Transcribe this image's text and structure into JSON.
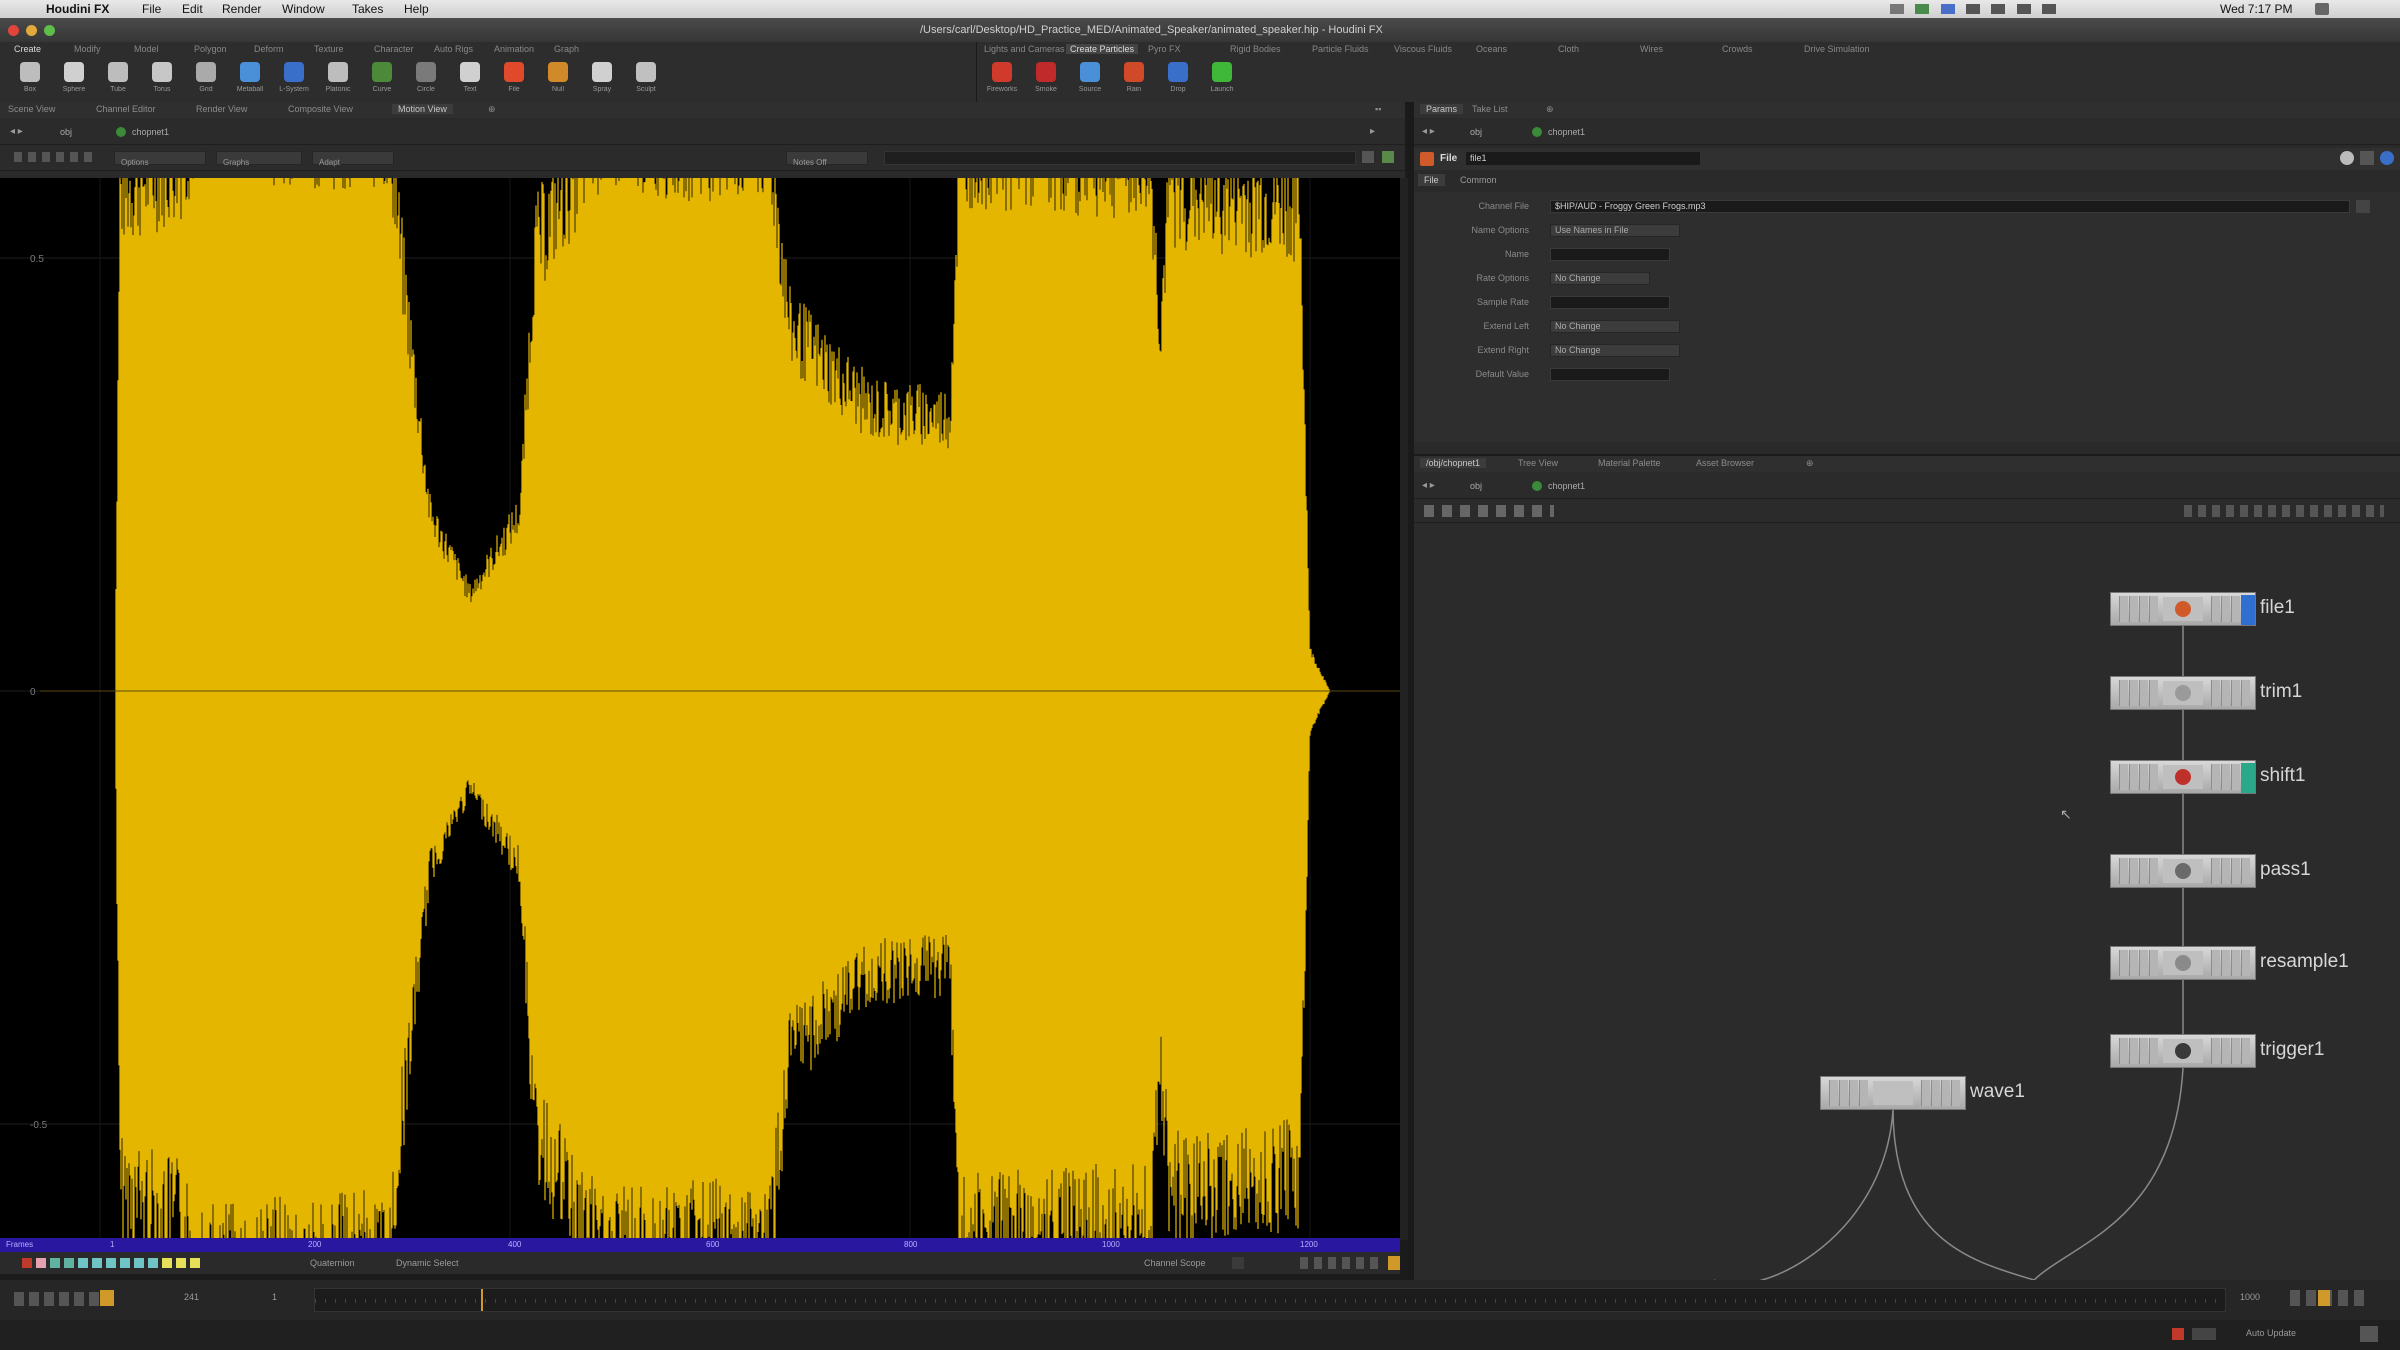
{
  "menubar": {
    "app": "Houdini FX",
    "items": [
      "File",
      "Edit",
      "Render",
      "Window",
      "Takes",
      "Help"
    ],
    "clock": "Wed 7:17 PM"
  },
  "titlebar": {
    "title": "/Users/carl/Desktop/HD_Practice_MED/Animated_Speaker/animated_speaker.hip - Houdini FX"
  },
  "shelf": {
    "left_tabs": [
      "Create",
      "Modify",
      "Model",
      "Polygon",
      "Deform",
      "Texture",
      "Character",
      "Auto Rigs",
      "Animation",
      "Graph"
    ],
    "right_tabs": [
      "Lights and Cameras",
      "Create Particles",
      "Pyro FX",
      "Rigid Bodies",
      "Particle Fluids",
      "Viscous Fluids",
      "Oceans",
      "Cloth",
      "Wires",
      "Crowds",
      "Drive Simulation"
    ],
    "left_tools": [
      {
        "label": "Box",
        "color": "#bdbdbd"
      },
      {
        "label": "Sphere",
        "color": "#d0d0d0"
      },
      {
        "label": "Tube",
        "color": "#bdbdbd"
      },
      {
        "label": "Torus",
        "color": "#c7c7c7"
      },
      {
        "label": "Grid",
        "color": "#aaaaaa"
      },
      {
        "label": "Metaball",
        "color": "#4a90d9"
      },
      {
        "label": "L-System",
        "color": "#3a6fc9"
      },
      {
        "label": "Platonic",
        "color": "#bdbdbd"
      },
      {
        "label": "Curve",
        "color": "#4c8a3a"
      },
      {
        "label": "Circle",
        "color": "#7a7a7a"
      },
      {
        "label": "Text",
        "color": "#d0d0d0"
      },
      {
        "label": "File",
        "color": "#e0492a"
      },
      {
        "label": "Null",
        "color": "#d08a2a"
      },
      {
        "label": "Spray",
        "color": "#d0d0d0"
      },
      {
        "label": "Sculpt",
        "color": "#c0c0c0"
      }
    ],
    "right_tools": [
      {
        "label": "Fireworks",
        "color": "#d03a2a"
      },
      {
        "label": "Smoke",
        "color": "#c02a2a"
      },
      {
        "label": "Source",
        "color": "#4a90d9"
      },
      {
        "label": "Rain",
        "color": "#d04a2a"
      },
      {
        "label": "Drop",
        "color": "#3a6fc9"
      },
      {
        "label": "Launch",
        "color": "#3fb83a"
      }
    ]
  },
  "left_pane": {
    "tabs": [
      "Scene View",
      "Channel Editor",
      "Render View",
      "Composite View",
      "Motion View"
    ],
    "path": "obj",
    "node": "chopnet1",
    "menus": [
      "Options",
      "Graphs",
      "Adapt"
    ],
    "right_menu": "Notes Off"
  },
  "graph": {
    "y_labels": [
      "0.5",
      "0",
      "-0.5"
    ],
    "x_labels": [
      "1",
      "200",
      "400",
      "600",
      "800",
      "1000",
      "1200"
    ],
    "x_label_prefix": "Frames",
    "waveform_color": "#f0c000"
  },
  "channel_bar": {
    "labels": [
      "Quaternion",
      "Dynamic Select",
      "Channel Scope"
    ],
    "chip_colors": [
      "#c0392b",
      "#e6a1b0",
      "#5fb3a0",
      "#5fb3a0",
      "#6fc5c5",
      "#6fc5c5",
      "#6fc5c5",
      "#6fc5c5",
      "#6fc5c5",
      "#6fc5c5",
      "#e6e05a",
      "#e6e05a",
      "#e6e05a"
    ]
  },
  "params_pane": {
    "tabs": [
      "Params",
      "Take List"
    ],
    "path": "obj",
    "node": "chopnet1",
    "node_type": "File",
    "node_name": "file1",
    "sub_tabs": [
      "File",
      "Common"
    ],
    "fields": [
      {
        "label": "Channel File",
        "value": "$HIP/AUD - Froggy Green Frogs.mp3",
        "type": "field",
        "width": 800
      },
      {
        "label": "Name Options",
        "value": "Use Names in File",
        "type": "menu",
        "width": 130
      },
      {
        "label": "Name",
        "value": "",
        "type": "field",
        "width": 120
      },
      {
        "label": "Rate Options",
        "value": "No Change",
        "type": "menu",
        "width": 100
      },
      {
        "label": "Sample Rate",
        "value": "",
        "type": "field",
        "width": 120
      },
      {
        "label": "Extend Left",
        "value": "No Change",
        "type": "menu",
        "width": 130
      },
      {
        "label": "Extend Right",
        "value": "No Change",
        "type": "menu",
        "width": 130
      },
      {
        "label": "Default Value",
        "value": "",
        "type": "field",
        "width": 120
      }
    ]
  },
  "network_pane": {
    "tabs": [
      "/obj/chopnet1",
      "Tree View",
      "Material Palette",
      "Asset Browser"
    ],
    "path": "obj",
    "node": "chopnet1",
    "nodes": [
      {
        "name": "file1",
        "flag": "#2e6fd0",
        "icon": "#d05a2a"
      },
      {
        "name": "trim1",
        "flag": "",
        "icon": "#9a9a9a"
      },
      {
        "name": "shift1",
        "flag": "#2aa88a",
        "icon": "#c0302a"
      },
      {
        "name": "pass1",
        "flag": "",
        "icon": "#6a6a6a"
      },
      {
        "name": "resample1",
        "flag": "",
        "icon": "#8a8a8a"
      },
      {
        "name": "trigger1",
        "flag": "",
        "icon": "#3a3a3a"
      },
      {
        "name": "wave1",
        "flag": "",
        "icon": ""
      }
    ]
  },
  "timeline": {
    "frame": "241",
    "start": "1",
    "end": "1000",
    "auto_update": "Auto Update"
  }
}
